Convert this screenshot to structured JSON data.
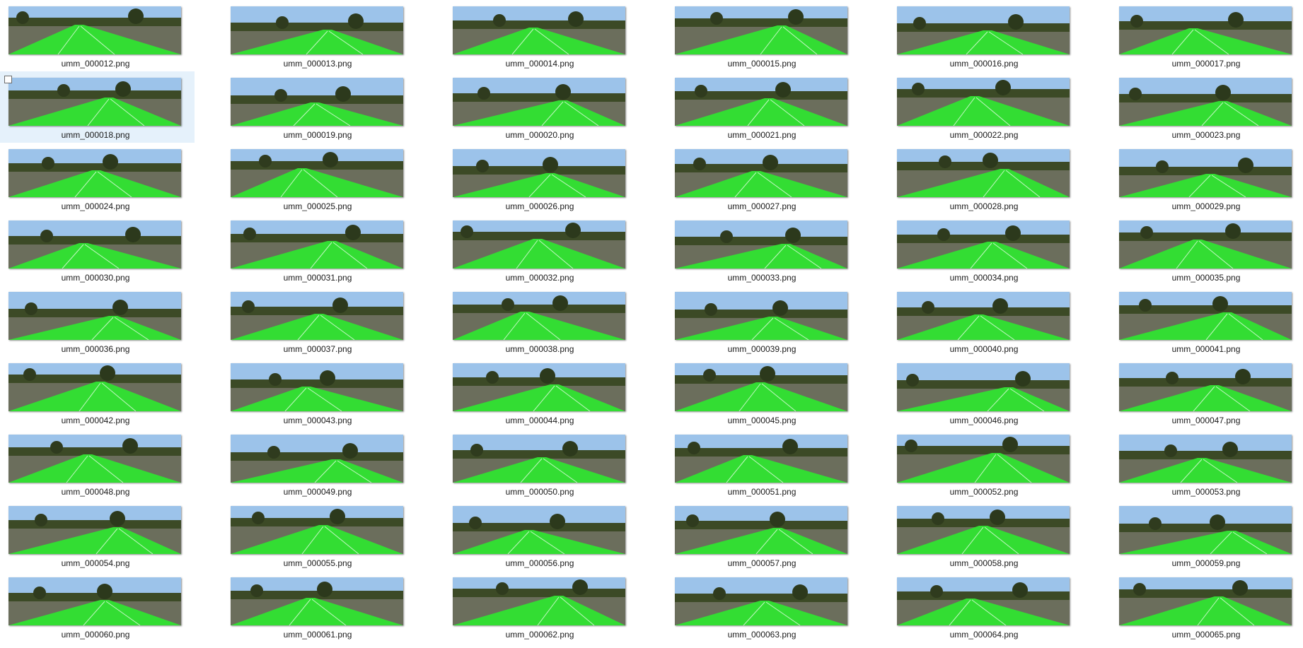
{
  "view": {
    "selected_file": "umm_000018.png",
    "overlay_color": "#33dd33",
    "sky_color": "#9cc3ea",
    "vegetation_color": "#3c4a26"
  },
  "files": [
    "umm_000012.png",
    "umm_000013.png",
    "umm_000014.png",
    "umm_000015.png",
    "umm_000016.png",
    "umm_000017.png",
    "umm_000018.png",
    "umm_000019.png",
    "umm_000020.png",
    "umm_000021.png",
    "umm_000022.png",
    "umm_000023.png",
    "umm_000024.png",
    "umm_000025.png",
    "umm_000026.png",
    "umm_000027.png",
    "umm_000028.png",
    "umm_000029.png",
    "umm_000030.png",
    "umm_000031.png",
    "umm_000032.png",
    "umm_000033.png",
    "umm_000034.png",
    "umm_000035.png",
    "umm_000036.png",
    "umm_000037.png",
    "umm_000038.png",
    "umm_000039.png",
    "umm_000040.png",
    "umm_000041.png",
    "umm_000042.png",
    "umm_000043.png",
    "umm_000044.png",
    "umm_000045.png",
    "umm_000046.png",
    "umm_000047.png",
    "umm_000048.png",
    "umm_000049.png",
    "umm_000050.png",
    "umm_000051.png",
    "umm_000052.png",
    "umm_000053.png",
    "umm_000054.png",
    "umm_000055.png",
    "umm_000056.png",
    "umm_000057.png",
    "umm_000058.png",
    "umm_000059.png",
    "umm_000060.png",
    "umm_000061.png",
    "umm_000062.png",
    "umm_000063.png",
    "umm_000064.png",
    "umm_000065.png"
  ]
}
